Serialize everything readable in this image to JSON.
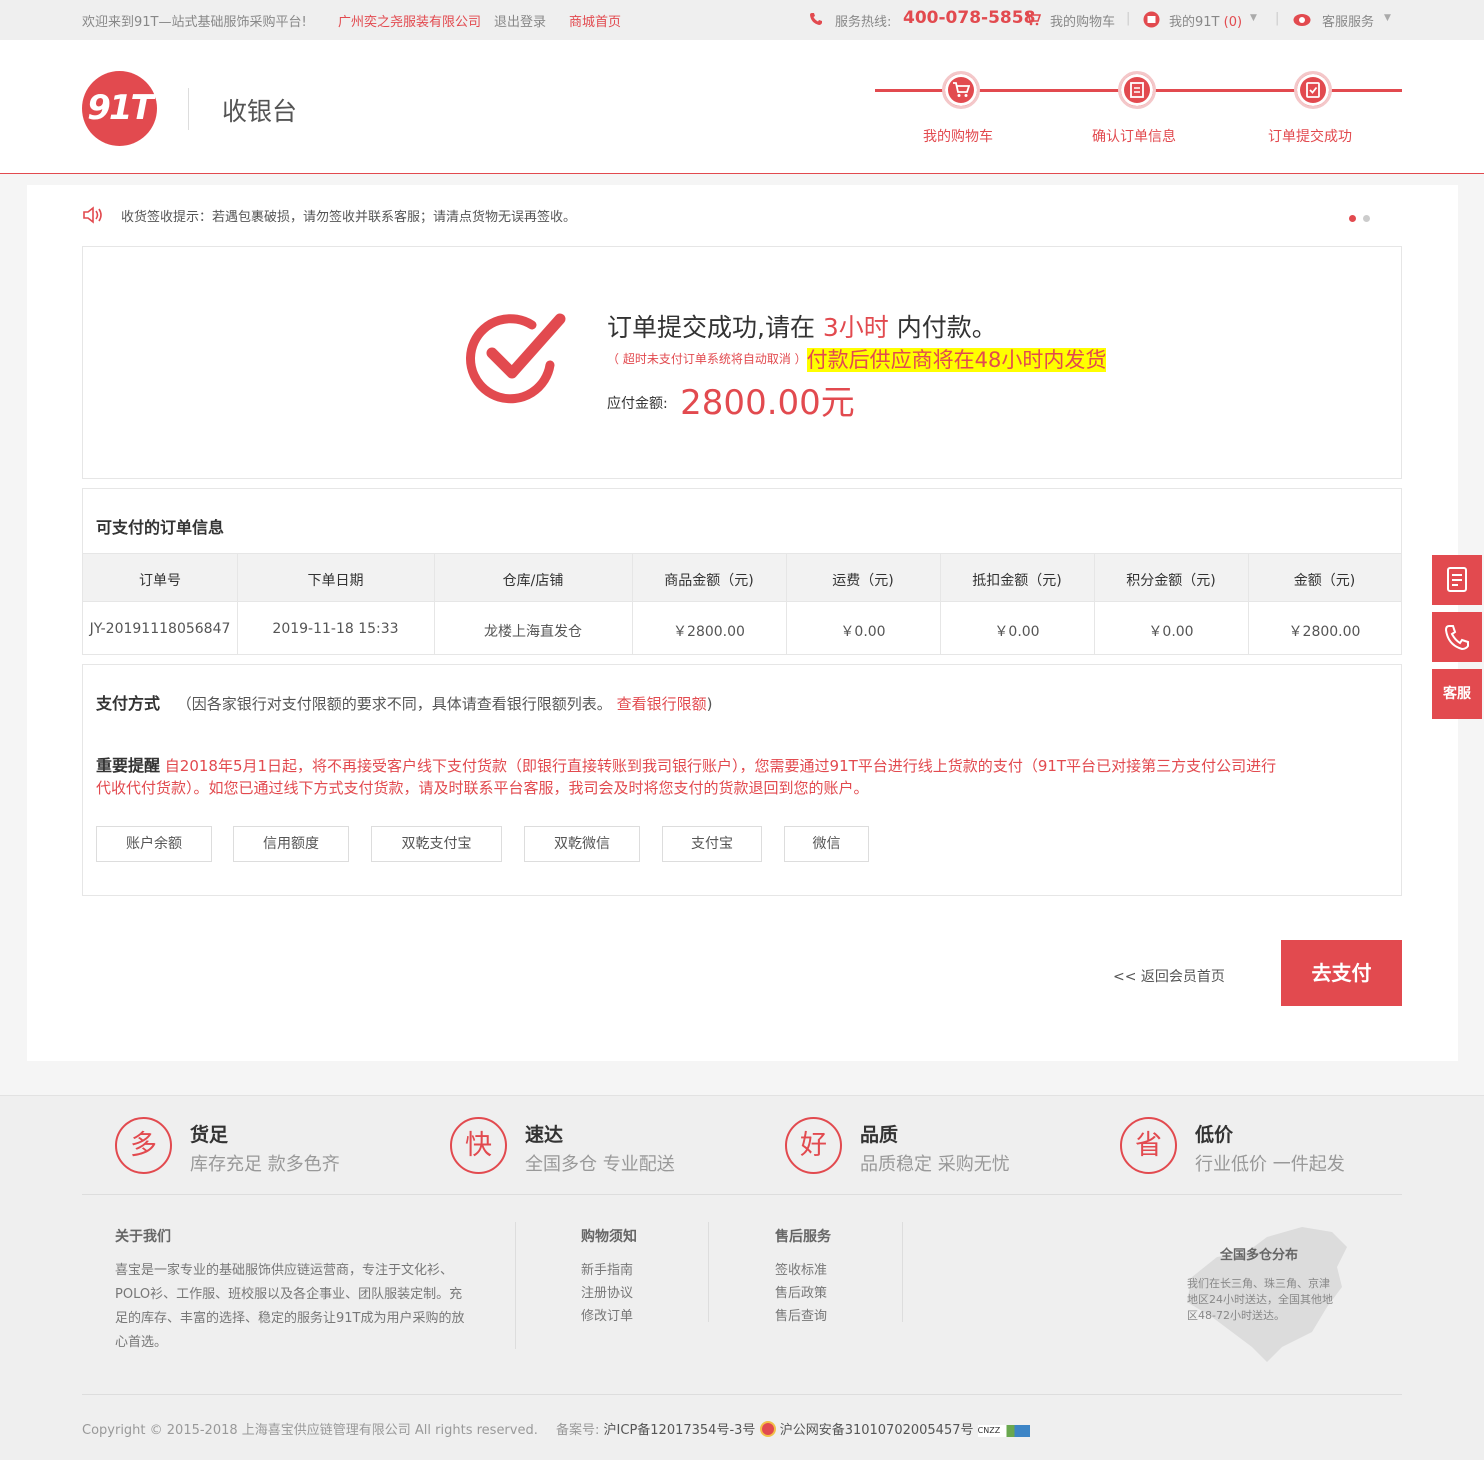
{
  "topbar": {
    "welcome": "欢迎来到91T—站式基础服饰采购平台!",
    "company": "广州奕之尧服装有限公司",
    "logout": "退出登录",
    "mall_home": "商城首页",
    "hotline_label": "服务热线:",
    "hotline_number": "400-078-5858",
    "cart": "我的购物车",
    "my91t": "我的91T",
    "my91t_count": "(0)",
    "service": "客服服务"
  },
  "header": {
    "logo_text": "91T",
    "title": "收银台",
    "steps": [
      "我的购物车",
      "确认订单信息",
      "订单提交成功"
    ]
  },
  "notice": {
    "text": "收货签收提示：若遇包裹破损，请勿签收并联系客服；请清点货物无误再签收。"
  },
  "success": {
    "title_prefix": "订单提交成功,请在",
    "hours": "3小时",
    "title_suffix": "内付款。",
    "timeout_note": "（ 超时未支付订单系统将自动取消 ）",
    "ship_note": "付款后供应商将在48小时内发货",
    "amount_label": "应付金额:",
    "amount": "2800.00元"
  },
  "orders": {
    "section_title": "可支付的订单信息",
    "headers": [
      "订单号",
      "下单日期",
      "仓库/店铺",
      "商品金额（元)",
      "运费（元)",
      "抵扣金额（元)",
      "积分金额（元)",
      "金额（元)"
    ],
    "row": [
      "JY-20191118056847",
      "2019-11-18 15:33",
      "龙楼上海直发仓",
      "￥2800.00",
      "￥0.00",
      "￥0.00",
      "￥0.00",
      "￥2800.00"
    ]
  },
  "payment": {
    "label": "支付方式",
    "note": "（因各家银行对支付限额的要求不同，具体请查看银行限额列表。",
    "bank_limit_link": "查看银行限额",
    "note_close": ")",
    "reminder_label": "重要提醒",
    "reminder_line1": "自2018年5月1日起，将不再接受客户线下支付货款（即银行直接转账到我司银行账户），您需要通过91T平台进行线上货款的支付（91T平台已对接第三方支付公司进行",
    "reminder_line2": "代收代付货款）。如您已通过线下方式支付货款，请及时联系平台客服，我司会及时将您支付的货款退回到您的账户。",
    "methods": [
      "账户余额",
      "信用额度",
      "双乾支付宝",
      "双乾微信",
      "支付宝",
      "微信"
    ]
  },
  "actions": {
    "back": "<< 返回会员首页",
    "pay": "去支付"
  },
  "side": {
    "service": "客服"
  },
  "features": [
    {
      "icon": "多",
      "title": "货足",
      "sub": "库存充足 款多色齐"
    },
    {
      "icon": "快",
      "title": "速达",
      "sub": "全国多仓 专业配送"
    },
    {
      "icon": "好",
      "title": "品质",
      "sub": "品质稳定 采购无忧"
    },
    {
      "icon": "省",
      "title": "低价",
      "sub": "行业低价 一件起发"
    }
  ],
  "footer": {
    "about_title": "关于我们",
    "about_lines": [
      "喜宝是一家专业的基础服饰供应链运营商，专注于文化衫、",
      "POLO衫、工作服、班校服以及各企事业、团队服装定制。充",
      "足的库存、丰富的选择、稳定的服务让91T成为用户采购的放",
      "心首选。"
    ],
    "shopping_title": "购物须知",
    "shopping_links": [
      "新手指南",
      "注册协议",
      "修改订单"
    ],
    "aftersale_title": "售后服务",
    "aftersale_links": [
      "签收标准",
      "售后政策",
      "售后查询"
    ],
    "map_title": "全国多仓分布",
    "map_lines": [
      "我们在长三角、珠三角、京津",
      "地区24小时送达，全国其他地",
      "区48-72小时送达。"
    ],
    "copyright": "Copyright © 2015-2018 上海喜宝供应链管理有限公司 All rights reserved.",
    "icp_label": "备案号:",
    "icp": "沪ICP备12017354号-3号",
    "police": "沪公网安备31010702005457号",
    "badge": "CNZZ"
  },
  "colors": {
    "accent": "#e24a4f",
    "highlight": "#ffff00"
  }
}
